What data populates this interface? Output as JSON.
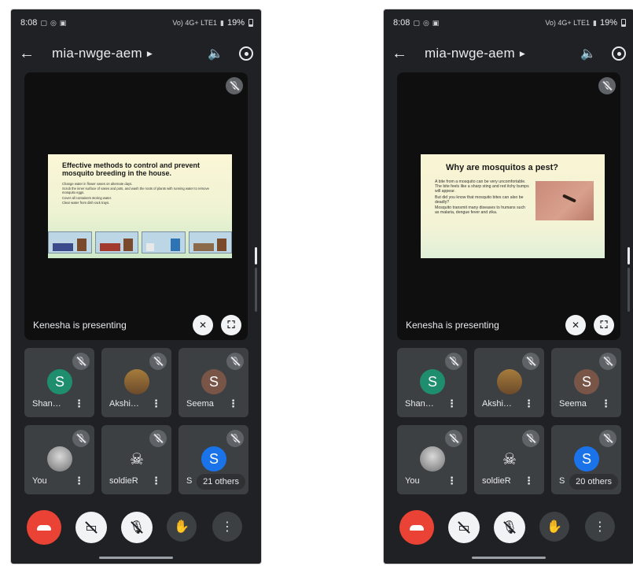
{
  "colors": {
    "background": "#202124",
    "tile": "#3c4043",
    "end_call": "#ea4335",
    "control_light": "#f1f3f4",
    "avatar_green": "#1e8e6e",
    "avatar_brown": "#795548",
    "avatar_blue": "#1a73e8"
  },
  "phones": [
    {
      "status": {
        "time": "8:08",
        "network": "Vo) 4G+ LTE1",
        "battery": "19%"
      },
      "meeting_code": "mia-nwge-aem",
      "presenter_text": "Kenesha is presenting",
      "slide": {
        "title": "Effective methods to control and prevent mosquito breeding in the house.",
        "bullets": [
          "Change water in flower vases on alternate days.",
          "Scrub the inner surface of vases and pots, and wash the roots of plants with running water to remove mosquito eggs.",
          "Cover all containers storing water.",
          "Clear water from dish rack trays."
        ]
      },
      "participants": [
        {
          "name": "Shan…",
          "initial": "S",
          "avatar": "letter-green"
        },
        {
          "name": "Akshi…",
          "initial": "",
          "avatar": "photo-icon"
        },
        {
          "name": "Seema",
          "initial": "S",
          "avatar": "letter-brown"
        },
        {
          "name": "You",
          "initial": "",
          "avatar": "photo-icon"
        },
        {
          "name": "soldieR",
          "initial": "",
          "avatar": "skull-icon"
        },
        {
          "name": "S",
          "initial": "S",
          "avatar": "letter-blue",
          "others": "21 others"
        }
      ]
    },
    {
      "status": {
        "time": "8:08",
        "network": "Vo) 4G+ LTE1",
        "battery": "19%"
      },
      "meeting_code": "mia-nwge-aem",
      "presenter_text": "Kenesha is presenting",
      "slide": {
        "title": "Why are mosquitos a pest?",
        "bullets": [
          "A bite from a mosquito can be very uncomfortable. The bite feels like a sharp sting and red itchy bumps will appear.",
          "But did you know that mosquito bites can also be deadly?",
          "Mosquito transmit many diseases to humans such as malaria, dengue fever and zika."
        ]
      },
      "participants": [
        {
          "name": "Shan…",
          "initial": "S",
          "avatar": "letter-green"
        },
        {
          "name": "Akshi…",
          "initial": "",
          "avatar": "photo-icon"
        },
        {
          "name": "Seema",
          "initial": "S",
          "avatar": "letter-brown"
        },
        {
          "name": "You",
          "initial": "",
          "avatar": "photo-icon"
        },
        {
          "name": "soldieR",
          "initial": "",
          "avatar": "skull-icon"
        },
        {
          "name": "S",
          "initial": "S",
          "avatar": "letter-blue",
          "others": "20 others"
        }
      ]
    }
  ]
}
